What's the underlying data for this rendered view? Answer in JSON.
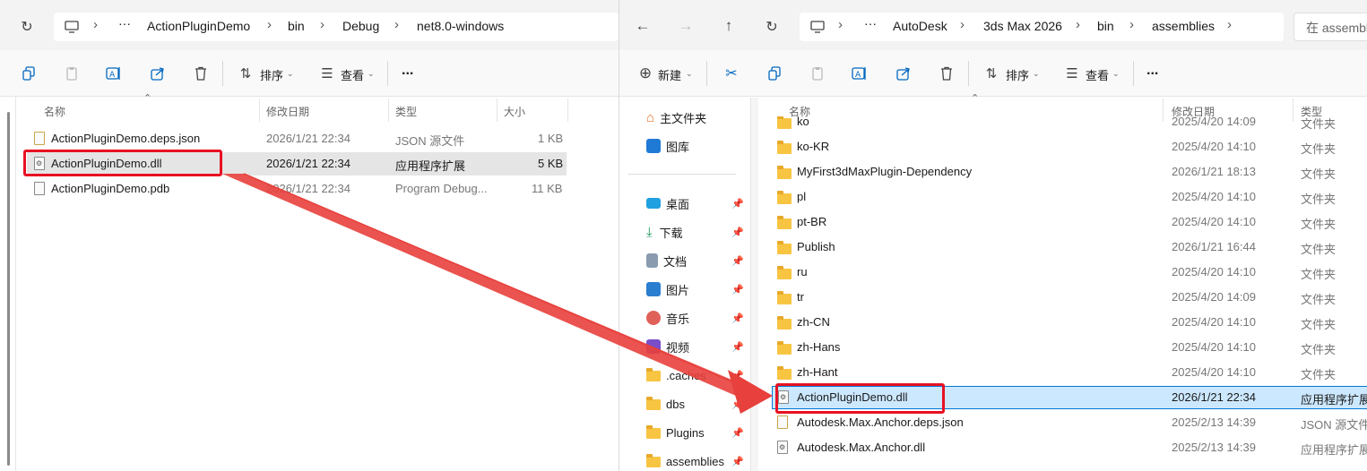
{
  "left": {
    "breadcrumb": [
      "ActionPluginDemo",
      "bin",
      "Debug",
      "net8.0-windows"
    ],
    "toolbar": {
      "sort_label": "排序",
      "view_label": "查看",
      "more_label": "..."
    },
    "columns": {
      "name": "名称",
      "date": "修改日期",
      "type": "类型",
      "size": "大小"
    },
    "files": [
      {
        "name": "ActionPluginDemo.deps.json",
        "date": "2026/1/21 22:34",
        "type": "JSON 源文件",
        "size": "1 KB",
        "icon": "json-file-icon"
      },
      {
        "name": "ActionPluginDemo.dll",
        "date": "2026/1/21 22:34",
        "type": "应用程序扩展",
        "size": "5 KB",
        "icon": "dll-file-icon"
      },
      {
        "name": "ActionPluginDemo.pdb",
        "date": "2026/1/21 22:34",
        "type": "Program Debug...",
        "size": "11 KB",
        "icon": "pdb-file-icon"
      }
    ]
  },
  "right": {
    "breadcrumb": [
      "AutoDesk",
      "3ds Max 2026",
      "bin",
      "assemblies"
    ],
    "search_placeholder": "在 assembl",
    "toolbar": {
      "new_label": "新建",
      "sort_label": "排序",
      "view_label": "查看",
      "more_label": "..."
    },
    "columns": {
      "name": "名称",
      "date": "修改日期",
      "type": "类型"
    },
    "nav": {
      "home": "主文件夹",
      "gallery": "图库",
      "pinned": [
        "桌面",
        "下载",
        "文档",
        "图片",
        "音乐",
        "视频",
        ".caches",
        "dbs",
        "Plugins",
        "assemblies"
      ]
    },
    "files": [
      {
        "name": "ko",
        "date": "2025/4/20 14:09",
        "type": "文件夹",
        "kind": "folder"
      },
      {
        "name": "ko-KR",
        "date": "2025/4/20 14:10",
        "type": "文件夹",
        "kind": "folder"
      },
      {
        "name": "MyFirst3dMaxPlugin-Dependency",
        "date": "2026/1/21 18:13",
        "type": "文件夹",
        "kind": "folder"
      },
      {
        "name": "pl",
        "date": "2025/4/20 14:10",
        "type": "文件夹",
        "kind": "folder"
      },
      {
        "name": "pt-BR",
        "date": "2025/4/20 14:10",
        "type": "文件夹",
        "kind": "folder"
      },
      {
        "name": "Publish",
        "date": "2026/1/21 16:44",
        "type": "文件夹",
        "kind": "folder"
      },
      {
        "name": "ru",
        "date": "2025/4/20 14:10",
        "type": "文件夹",
        "kind": "folder"
      },
      {
        "name": "tr",
        "date": "2025/4/20 14:09",
        "type": "文件夹",
        "kind": "folder"
      },
      {
        "name": "zh-CN",
        "date": "2025/4/20 14:10",
        "type": "文件夹",
        "kind": "folder"
      },
      {
        "name": "zh-Hans",
        "date": "2025/4/20 14:10",
        "type": "文件夹",
        "kind": "folder"
      },
      {
        "name": "zh-Hant",
        "date": "2025/4/20 14:10",
        "type": "文件夹",
        "kind": "folder"
      },
      {
        "name": "ActionPluginDemo.dll",
        "date": "2026/1/21 22:34",
        "type": "应用程序扩展",
        "kind": "dll"
      },
      {
        "name": "Autodesk.Max.Anchor.deps.json",
        "date": "2025/2/13 14:39",
        "type": "JSON 源文件",
        "kind": "json"
      },
      {
        "name": "Autodesk.Max.Anchor.dll",
        "date": "2025/2/13 14:39",
        "type": "应用程序扩展",
        "kind": "dll"
      }
    ]
  },
  "colors": {
    "selection": "#cce8ff",
    "selection_border": "#0078d4",
    "highlight": "#e81123",
    "folder": "#f8c543"
  }
}
